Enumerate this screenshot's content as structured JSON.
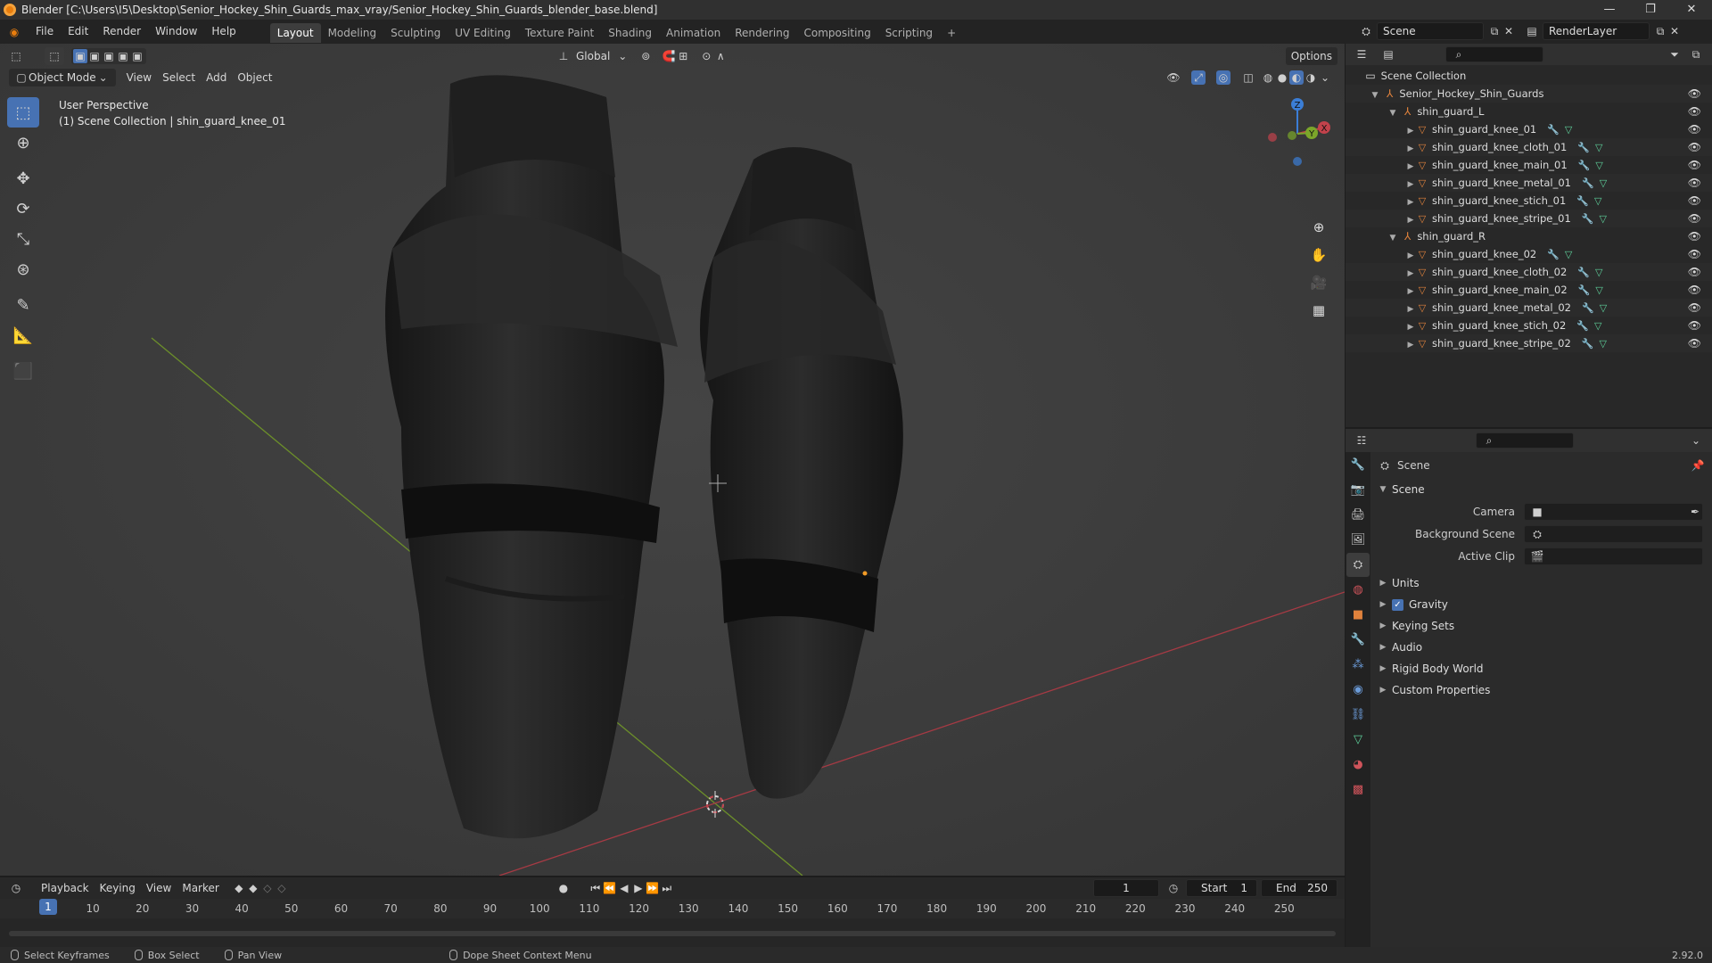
{
  "window": {
    "title": "Blender [C:\\Users\\I5\\Desktop\\Senior_Hockey_Shin_Guards_max_vray/Senior_Hockey_Shin_Guards_blender_base.blend]",
    "controls": [
      "—",
      "❐",
      "✕"
    ]
  },
  "menu": {
    "items": [
      "File",
      "Edit",
      "Render",
      "Window",
      "Help"
    ],
    "workspaces": [
      "Layout",
      "Modeling",
      "Sculpting",
      "UV Editing",
      "Texture Paint",
      "Shading",
      "Animation",
      "Rendering",
      "Compositing",
      "Scripting"
    ],
    "active_workspace": "Layout",
    "add_workspace": "+",
    "scene": "Scene",
    "render_layer": "RenderLayer"
  },
  "viewport": {
    "orientation": "Global",
    "options": "Options",
    "mode": "Object Mode",
    "menus": [
      "View",
      "Select",
      "Add",
      "Object"
    ],
    "info_line1": "User Perspective",
    "info_line2": "(1) Scene Collection | shin_guard_knee_01",
    "gizmo": {
      "x": "X",
      "y": "Y",
      "z": "Z"
    }
  },
  "outliner": {
    "root": "Scene Collection",
    "collection": "Senior_Hockey_Shin_Guards",
    "groups": [
      {
        "name": "shin_guard_L",
        "children": [
          "shin_guard_knee_01",
          "shin_guard_knee_cloth_01",
          "shin_guard_knee_main_01",
          "shin_guard_knee_metal_01",
          "shin_guard_knee_stich_01",
          "shin_guard_knee_stripe_01"
        ]
      },
      {
        "name": "shin_guard_R",
        "children": [
          "shin_guard_knee_02",
          "shin_guard_knee_cloth_02",
          "shin_guard_knee_main_02",
          "shin_guard_knee_metal_02",
          "shin_guard_knee_stich_02",
          "shin_guard_knee_stripe_02"
        ]
      }
    ]
  },
  "properties": {
    "context": "Scene",
    "panel": "Scene",
    "fields": [
      {
        "label": "Camera",
        "value": ""
      },
      {
        "label": "Background Scene",
        "value": ""
      },
      {
        "label": "Active Clip",
        "value": ""
      }
    ],
    "subpanels": [
      "Units",
      "Gravity",
      "Keying Sets",
      "Audio",
      "Rigid Body World",
      "Custom Properties"
    ],
    "gravity_checked": true
  },
  "timeline": {
    "menus": [
      "Playback",
      "Keying",
      "View",
      "Marker"
    ],
    "current_frame": "1",
    "start_label": "Start",
    "start": "1",
    "end_label": "End",
    "end": "250",
    "ticks": [
      "10",
      "20",
      "30",
      "40",
      "50",
      "60",
      "70",
      "80",
      "90",
      "100",
      "110",
      "120",
      "130",
      "140",
      "150",
      "160",
      "170",
      "180",
      "190",
      "200",
      "210",
      "220",
      "230",
      "240",
      "250"
    ],
    "cursor_label": "1"
  },
  "status": {
    "items": [
      "Select Keyframes",
      "Box Select",
      "Pan View",
      "Dope Sheet Context Menu"
    ],
    "version": "2.92.0"
  },
  "colors": {
    "accent": "#4772b3",
    "x_axis": "#c2424b",
    "y_axis": "#7ba62a",
    "z_axis": "#3b7ed6",
    "object_orange": "#e0823c"
  }
}
